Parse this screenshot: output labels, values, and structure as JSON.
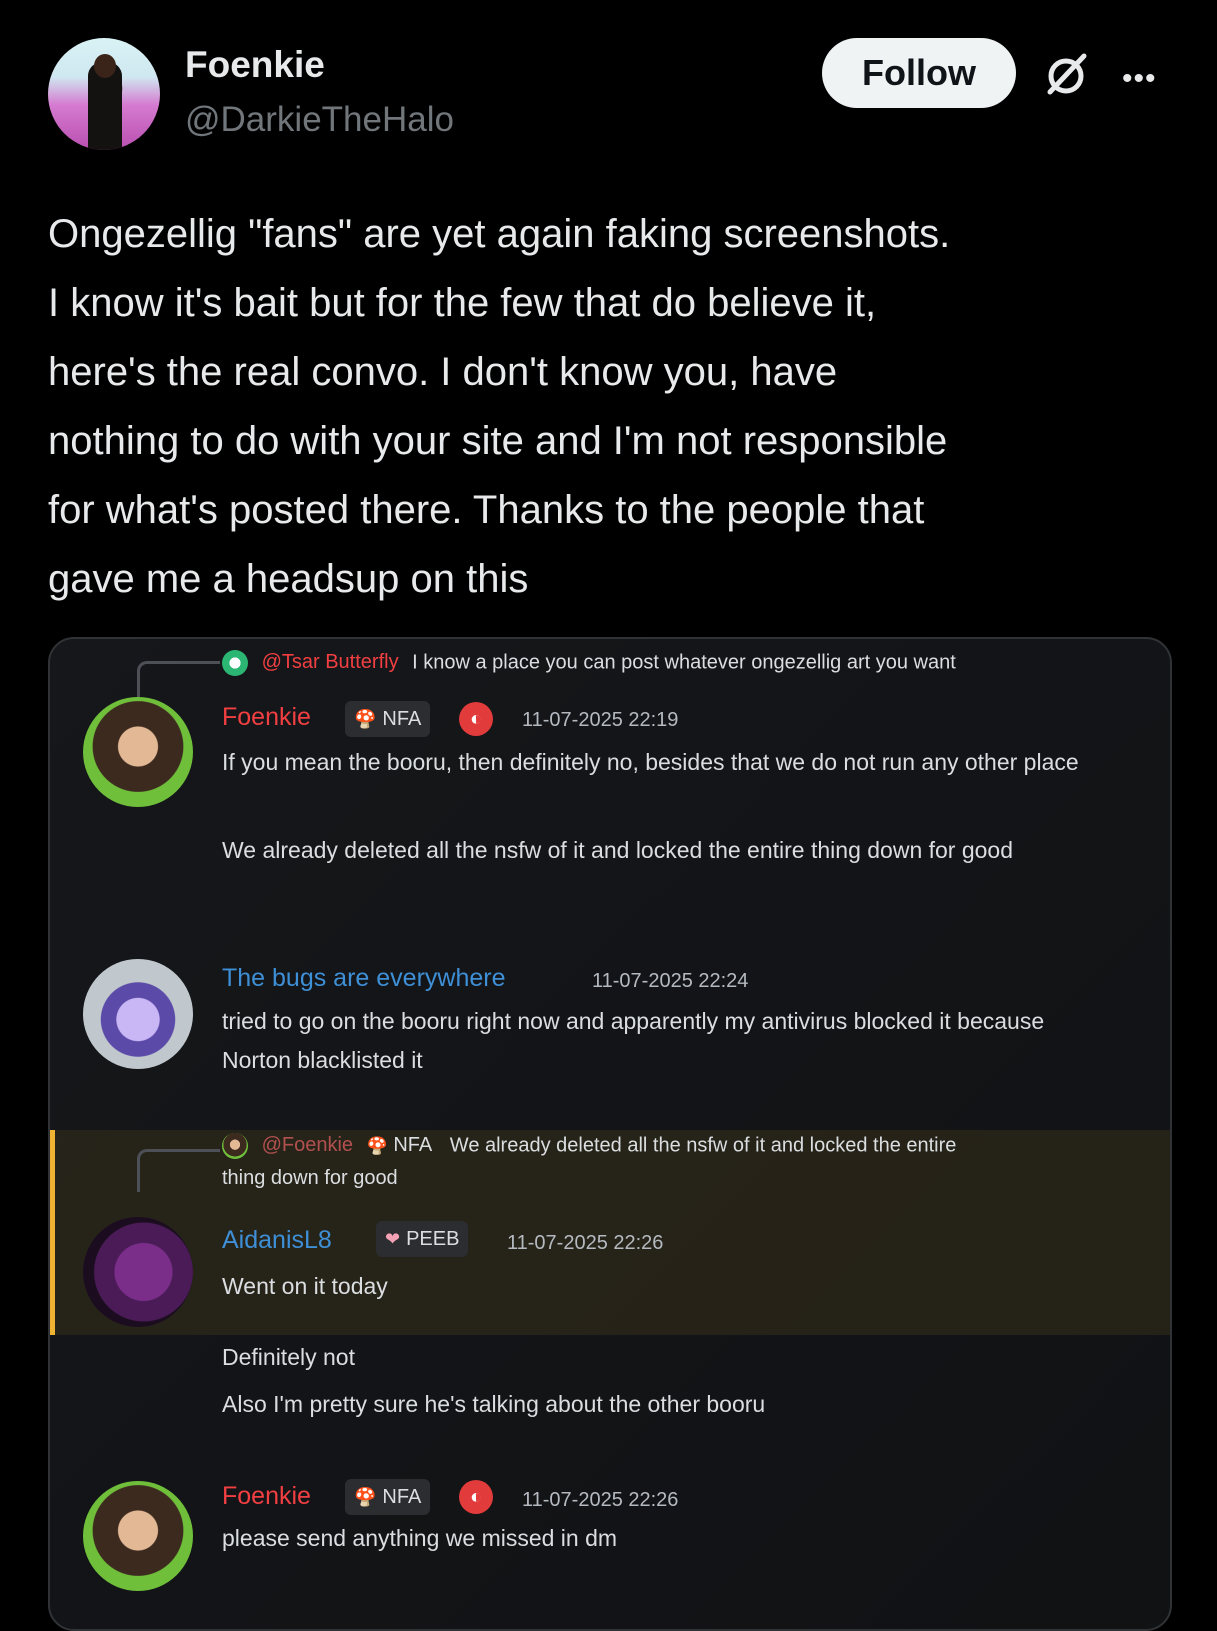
{
  "tweet": {
    "author_name": "Foenkie",
    "author_handle": "@DarkieTheHalo",
    "follow_label": "Follow",
    "more_label": "•••",
    "text": "Ongezellig \"fans\" are yet again faking screenshots.\nI know it's bait but for the few that do believe it,\nhere's the real convo. I don't know you, have\nnothing to do with your site and I'm not responsible\nfor what's posted there. Thanks to the people that\ngave me a headsup on this"
  },
  "discord": {
    "reply1": {
      "mention": "@Tsar Butterfly",
      "text": "I know a place you can post whatever ongezellig art you want"
    },
    "msg1": {
      "username": "Foenkie",
      "badge": "NFA",
      "timestamp": "11-07-2025 22:19",
      "lines": [
        "If you mean the booru, then definitely no, besides that we do not run any other place",
        "We already deleted all the nsfw of it and locked the entire thing down for good"
      ]
    },
    "msg2": {
      "username": "The bugs are everywhere",
      "timestamp": "11-07-2025 22:24",
      "text": "tried to go on the booru right now and apparently my antivirus blocked it because Norton blacklisted it"
    },
    "reply2": {
      "mention": "@Foenkie",
      "badge": "NFA",
      "text_line1": "We already deleted all the nsfw of it and locked the entire",
      "text_line2": "thing down for good"
    },
    "msg3": {
      "username": "AidanisL8",
      "badge": "PEEB",
      "timestamp": "11-07-2025 22:26",
      "text": "Went on it today"
    },
    "followups": [
      "Definitely not",
      "Also I'm pretty sure he's talking about the other booru"
    ],
    "msg4": {
      "username": "Foenkie",
      "badge": "NFA",
      "timestamp": "11-07-2025 22:26",
      "text": "please send anything we missed in dm"
    }
  },
  "icons": {
    "grok": "grok-icon",
    "more": "more-icon"
  },
  "colors": {
    "username_red": "#f23f42",
    "username_blue": "#3e8fd6",
    "highlight_bar": "#f0b232"
  }
}
